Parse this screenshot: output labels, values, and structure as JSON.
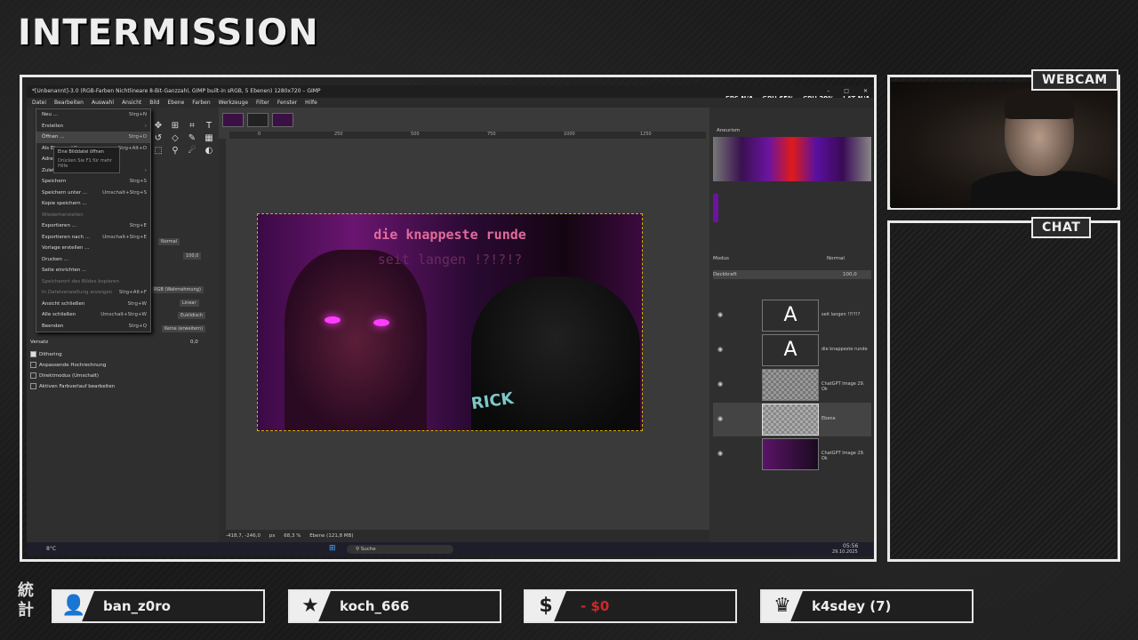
{
  "overlay": {
    "title": "INTERMISSION",
    "webcam_label": "WEBCAM",
    "chat_label": "CHAT",
    "kanji": [
      "統",
      "計"
    ],
    "stats": [
      {
        "icon": "add-user-icon",
        "value": "ban_z0ro"
      },
      {
        "icon": "star-icon",
        "value": "koch_666"
      },
      {
        "icon": "dollar-icon",
        "value": "- $0"
      },
      {
        "icon": "crown-icon",
        "value": "k4sdey (7)"
      }
    ]
  },
  "gimp": {
    "window_title": "*[Unbenannt]-3.0 (RGB-Farben Nichtlineare 8-Bit-Ganzzahl, GIMP built-in sRGB, 5 Ebenen) 1280x720 – GIMP",
    "menubar": [
      "Datei",
      "Bearbeiten",
      "Auswahl",
      "Ansicht",
      "Bild",
      "Ebene",
      "Farben",
      "Werkzeuge",
      "Filter",
      "Fenster",
      "Hilfe"
    ],
    "perf": {
      "fps_label": "FPS",
      "fps": "N/A",
      "gpu_label": "GPU",
      "gpu": "65%",
      "cpu_label": "CPU",
      "cpu": "29%",
      "lat_label": "LAT",
      "lat": "N/A"
    },
    "file_menu": [
      {
        "label": "Neu ...",
        "shortcut": "Strg+N"
      },
      {
        "label": "Erstellen",
        "shortcut": "›"
      },
      {
        "label": "Öffnen ...",
        "shortcut": "Strg+O"
      },
      {
        "label": "Als Ebenen öffnen ...",
        "shortcut": "Strg+Alt+O"
      },
      {
        "label": "Adresse öffnen ...",
        "shortcut": ""
      },
      {
        "label": "Zuletzt geöffnet",
        "shortcut": "›"
      },
      {
        "label": "Speichern",
        "shortcut": "Strg+S"
      },
      {
        "label": "Speichern unter ...",
        "shortcut": "Umschalt+Strg+S"
      },
      {
        "label": "Kopie speichern ...",
        "shortcut": ""
      },
      {
        "label": "Wiederherstellen",
        "shortcut": ""
      },
      {
        "label": "Exportieren ...",
        "shortcut": "Strg+E"
      },
      {
        "label": "Exportieren nach ...",
        "shortcut": "Umschalt+Strg+E"
      },
      {
        "label": "Vorlage erstellen ...",
        "shortcut": ""
      },
      {
        "label": "Drucken ...",
        "shortcut": ""
      },
      {
        "label": "Seite einrichten ...",
        "shortcut": ""
      },
      {
        "label": "Speicherort des Bildes kopieren",
        "shortcut": ""
      },
      {
        "label": "In Dateiverwaltung anzeigen",
        "shortcut": "Strg+Alt+F"
      },
      {
        "label": "Ansicht schließen",
        "shortcut": "Strg+W"
      },
      {
        "label": "Alle schließen",
        "shortcut": "Umschalt+Strg+W"
      },
      {
        "label": "Beenden",
        "shortcut": "Strg+Q"
      }
    ],
    "tooltip": {
      "line1": "Eine Bilddatei öffnen",
      "line2": "Drücken Sie F1 für mehr Hilfe"
    },
    "tool_options": {
      "mode": "Normal",
      "opacity": "100,0",
      "space": "RGB (Wahrnehmung)",
      "shape": "Linear",
      "metric": "Euklidisch",
      "repeat": "Keine (erweitern)",
      "offset_label": "Versatz",
      "offset": "0,0",
      "dithering": "Dithering",
      "adaptive": "Anpassende Hochrechnung",
      "direct": "Direktmodus (Umschalt)",
      "edit_gradient": "Aktiven Farbverlauf bearbeiten"
    },
    "ruler_marks": [
      "0",
      "250",
      "500",
      "750",
      "1000",
      "1250"
    ],
    "image_text": {
      "line1": "die knappeste runde",
      "line2": "seit langen !?!?!?",
      "graffiti": "RICK"
    },
    "status": {
      "coords": "-418,7, -246,0",
      "unit": "px",
      "zoom": "68,3 %",
      "layer": "Ebene (121,8 MB)"
    },
    "gradient_name": "Aneurism",
    "layers_panel": {
      "mode_label": "Modus",
      "mode": "Normal",
      "opacity_label": "Deckkraft",
      "opacity": "100,0"
    },
    "layers": [
      {
        "name": "seit langen !?!?!?"
      },
      {
        "name": "die knappeste runde"
      },
      {
        "name": "ChatGPT Image 29. Ok"
      },
      {
        "name": "Ebene"
      },
      {
        "name": "ChatGPT Image 29. Ok"
      }
    ],
    "taskbar": {
      "weather": "8°C",
      "search": "Suche",
      "time": "05:56",
      "date": "29.10.2025"
    }
  }
}
